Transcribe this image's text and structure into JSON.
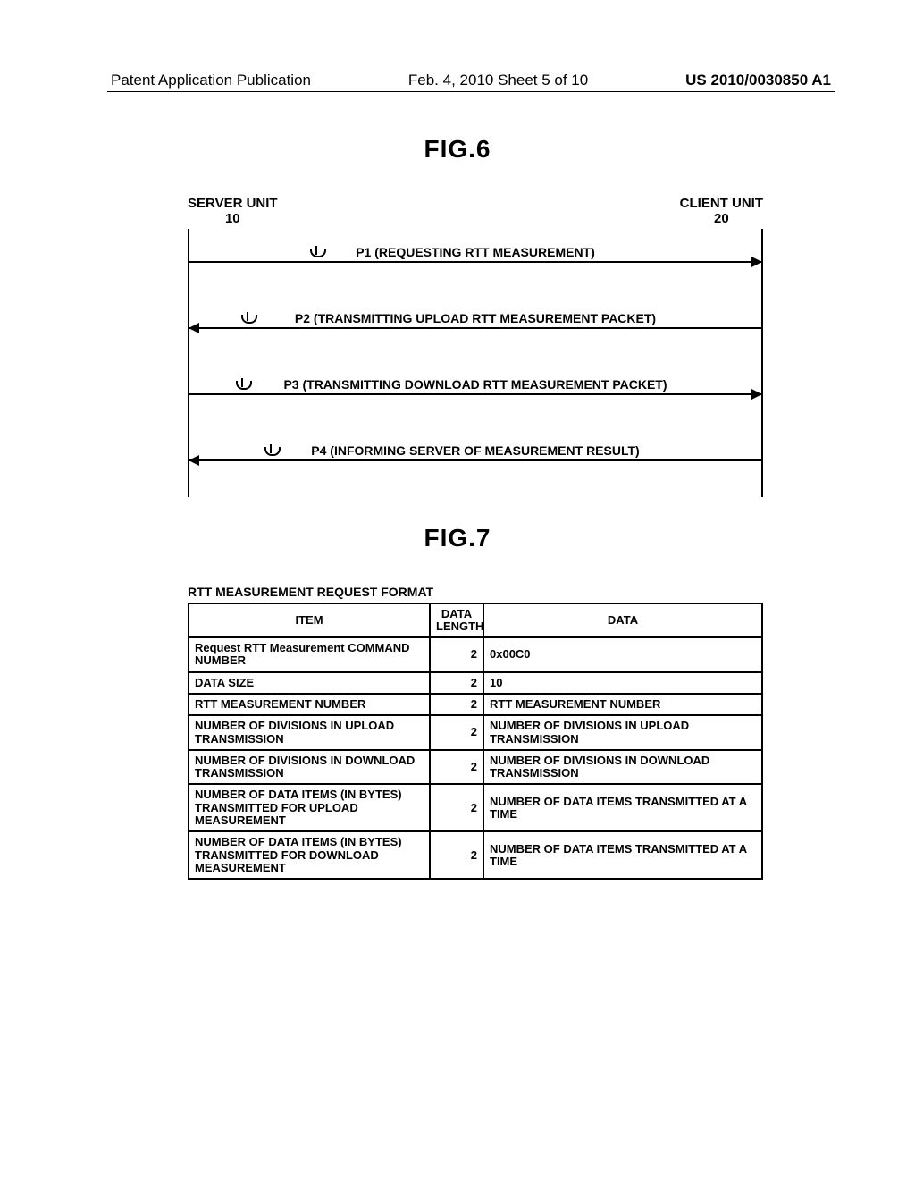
{
  "header": {
    "left": "Patent Application Publication",
    "center": "Feb. 4, 2010  Sheet 5 of 10",
    "right": "US 2010/0030850 A1"
  },
  "fig6": {
    "title": "FIG.6",
    "server": {
      "label": "SERVER UNIT",
      "num": "10"
    },
    "client": {
      "label": "CLIENT UNIT",
      "num": "20"
    },
    "msgs": [
      {
        "text": "P1 (REQUESTING RTT MEASUREMENT)",
        "dir": "r"
      },
      {
        "text": "P2 (TRANSMITTING UPLOAD RTT MEASUREMENT PACKET)",
        "dir": "l"
      },
      {
        "text": "P3 (TRANSMITTING DOWNLOAD RTT MEASUREMENT PACKET)",
        "dir": "r"
      },
      {
        "text": "P4 (INFORMING SERVER OF MEASUREMENT RESULT)",
        "dir": "l"
      }
    ]
  },
  "fig7": {
    "title": "FIG.7",
    "caption": "RTT MEASUREMENT REQUEST FORMAT",
    "cols": {
      "item": "ITEM",
      "len": "DATA LENGTH",
      "data": "DATA"
    },
    "rows": [
      {
        "item": "Request RTT Measurement COMMAND NUMBER",
        "len": "2",
        "data": "0x00C0"
      },
      {
        "item": "DATA SIZE",
        "len": "2",
        "data": "10"
      },
      {
        "item": "RTT MEASUREMENT NUMBER",
        "len": "2",
        "data": "RTT MEASUREMENT NUMBER"
      },
      {
        "item": "NUMBER OF DIVISIONS IN UPLOAD TRANSMISSION",
        "len": "2",
        "data": "NUMBER OF DIVISIONS IN UPLOAD TRANSMISSION"
      },
      {
        "item": "NUMBER OF DIVISIONS IN DOWNLOAD TRANSMISSION",
        "len": "2",
        "data": "NUMBER OF DIVISIONS IN DOWNLOAD TRANSMISSION"
      },
      {
        "item": "NUMBER OF DATA ITEMS (IN BYTES) TRANSMITTED FOR UPLOAD MEASUREMENT",
        "len": "2",
        "data": "NUMBER OF DATA ITEMS TRANSMITTED AT A TIME"
      },
      {
        "item": "NUMBER OF DATA ITEMS (IN BYTES) TRANSMITTED FOR DOWNLOAD MEASUREMENT",
        "len": "2",
        "data": "NUMBER OF DATA ITEMS TRANSMITTED AT A TIME"
      }
    ]
  }
}
